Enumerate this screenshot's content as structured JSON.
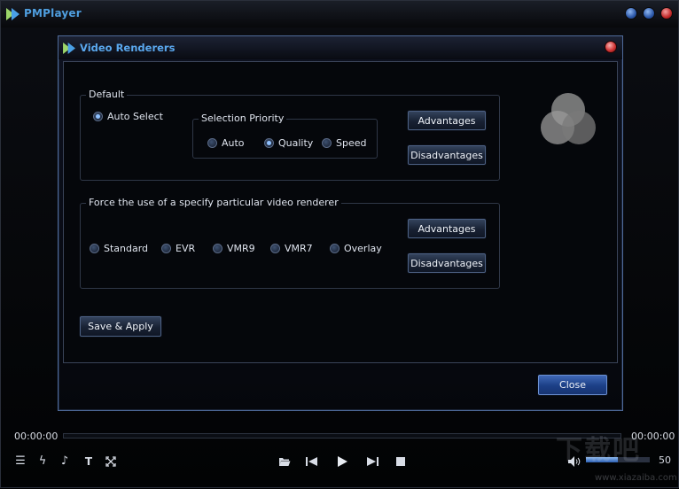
{
  "app": {
    "title": "PMPlayer",
    "window_buttons": [
      "minimize",
      "maximize",
      "close"
    ]
  },
  "dialog": {
    "title": "Video Renderers",
    "default_group": {
      "legend": "Default",
      "auto_select_label": "Auto Select",
      "auto_select_checked": true,
      "priority": {
        "legend": "Selection Priority",
        "options": [
          {
            "label": "Auto",
            "checked": false
          },
          {
            "label": "Quality",
            "checked": true
          },
          {
            "label": "Speed",
            "checked": false
          }
        ]
      },
      "advantages_label": "Advantages",
      "disadvantages_label": "Disadvantages"
    },
    "force_group": {
      "legend": "Force the use of a specify particular video renderer",
      "options": [
        {
          "label": "Standard",
          "checked": false
        },
        {
          "label": "EVR",
          "checked": false
        },
        {
          "label": "VMR9",
          "checked": false
        },
        {
          "label": "VMR7",
          "checked": false
        },
        {
          "label": "Overlay",
          "checked": false
        }
      ],
      "advantages_label": "Advantages",
      "disadvantages_label": "Disadvantages"
    },
    "save_label": "Save & Apply",
    "close_label": "Close"
  },
  "player": {
    "time_elapsed": "00:00:00",
    "time_total": "00:00:00",
    "seek_progress": 0,
    "volume_value": "50",
    "volume_fraction": 0.5,
    "icons": [
      "playlist-icon",
      "flash-icon",
      "music-note-icon",
      "text-icon",
      "fullscreen-icon",
      "open-folder-icon",
      "previous-icon",
      "play-icon",
      "next-icon",
      "stop-icon",
      "speaker-icon"
    ]
  },
  "watermark": {
    "text": "下载吧",
    "url": "www.xiazaiba.com"
  },
  "colors": {
    "accent": "#4f9fe0",
    "close_red": "#d03434",
    "primary_button": "#1c3f86"
  }
}
